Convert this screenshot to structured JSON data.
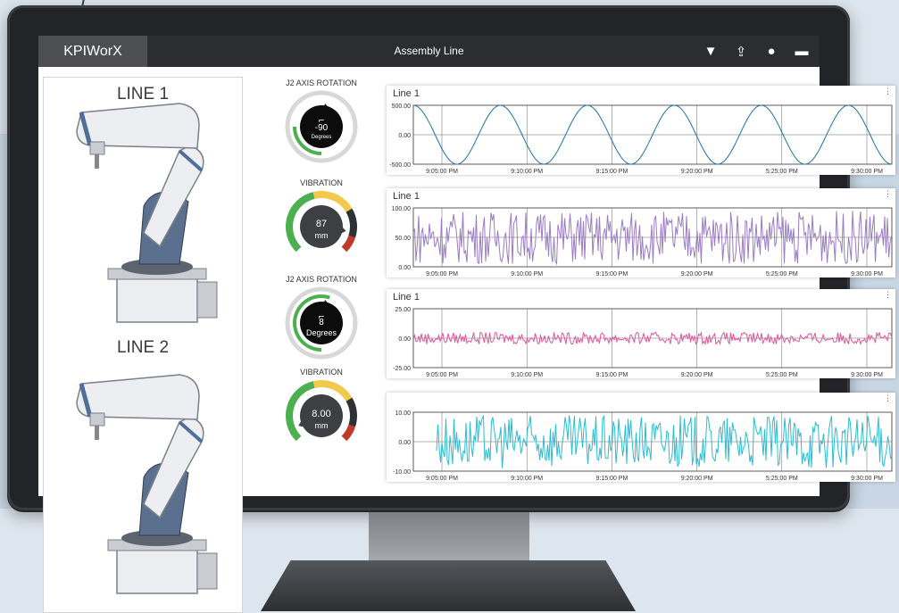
{
  "app": {
    "brand": "KPIWorX",
    "title": "Assembly Line",
    "toolbar": [
      {
        "icon": "filter-icon",
        "glyph": "▼"
      },
      {
        "icon": "export-icon",
        "glyph": "⇪"
      },
      {
        "icon": "user-icon",
        "glyph": "●"
      },
      {
        "icon": "chat-icon",
        "glyph": "▬"
      }
    ]
  },
  "lines": [
    {
      "label": "LINE 1"
    },
    {
      "label": "LINE 2"
    }
  ],
  "gauges": [
    {
      "title": "J2 AXIS ROTATION",
      "value": "-90",
      "unit": "Degrees",
      "level": 0.25
    },
    {
      "title": "VIBRATION",
      "value": "87",
      "unit": "mm",
      "level": 0.87
    },
    {
      "title": "J2 AXIS ROTATION",
      "value": "8",
      "unit": "Degrees",
      "level": 0.55
    },
    {
      "title": "VIBRATION",
      "value": "8.00",
      "unit": "mm",
      "level": 0.08
    }
  ],
  "colors": {
    "sine": "#1f6fa5",
    "purple": "#9b7bc4",
    "pink": "#e0559a",
    "cyan": "#2bbcd2",
    "green": "#4caf50",
    "yellow": "#f2c94c",
    "dark": "#2e3235",
    "red": "#c0392b"
  },
  "chart_data": [
    {
      "type": "line",
      "title": "Line 1",
      "x": [
        "9:05:00 PM",
        "9:10:00 PM",
        "9:15:00 PM",
        "9:20:00 PM",
        "5:25:00 PM",
        "9:30:00 PM"
      ],
      "yticks": [
        "500.00",
        "0.00",
        "-500.00"
      ],
      "ylim": [
        -500,
        500
      ],
      "series": [
        {
          "kind": "sine",
          "periods": 5.5,
          "amplitude": 500,
          "color": "#1f6fa5"
        }
      ]
    },
    {
      "type": "line",
      "title": "Line 1",
      "x": [
        "9:05:00 PM",
        "9:10:00 PM",
        "9:15:00 PM",
        "9:20:00 PM",
        "5:25:00 PM",
        "9:30:00 PM"
      ],
      "yticks": [
        "100.00",
        "50.00",
        "0.00"
      ],
      "ylim": [
        0,
        100
      ],
      "series": [
        {
          "kind": "noise",
          "center": 50,
          "spread": 45,
          "color": "#9b7bc4"
        }
      ]
    },
    {
      "type": "line",
      "title": "Line 1",
      "x": [
        "9:05:00 PM",
        "9:10:00 PM",
        "9:15:00 PM",
        "9:20:00 PM",
        "5:25:00 PM",
        "9:30:00 PM"
      ],
      "yticks": [
        "25.00",
        "0.00",
        "-25.00"
      ],
      "ylim": [
        -25,
        25
      ],
      "series": [
        {
          "kind": "noise",
          "center": 0,
          "spread": 5,
          "color": "#e0559a"
        }
      ]
    },
    {
      "type": "line",
      "title": "",
      "x": [
        "9:05:00 PM",
        "9:10:00 PM",
        "9:15:00 PM",
        "9:20:00 PM",
        "5:25:00 PM",
        "9:30:00 PM"
      ],
      "yticks": [
        "10.00",
        "0.00",
        "-10.00"
      ],
      "ylim": [
        -10,
        10
      ],
      "series": [
        {
          "kind": "noise",
          "center": 0,
          "spread": 9,
          "color": "#2bbcd2"
        }
      ]
    }
  ]
}
